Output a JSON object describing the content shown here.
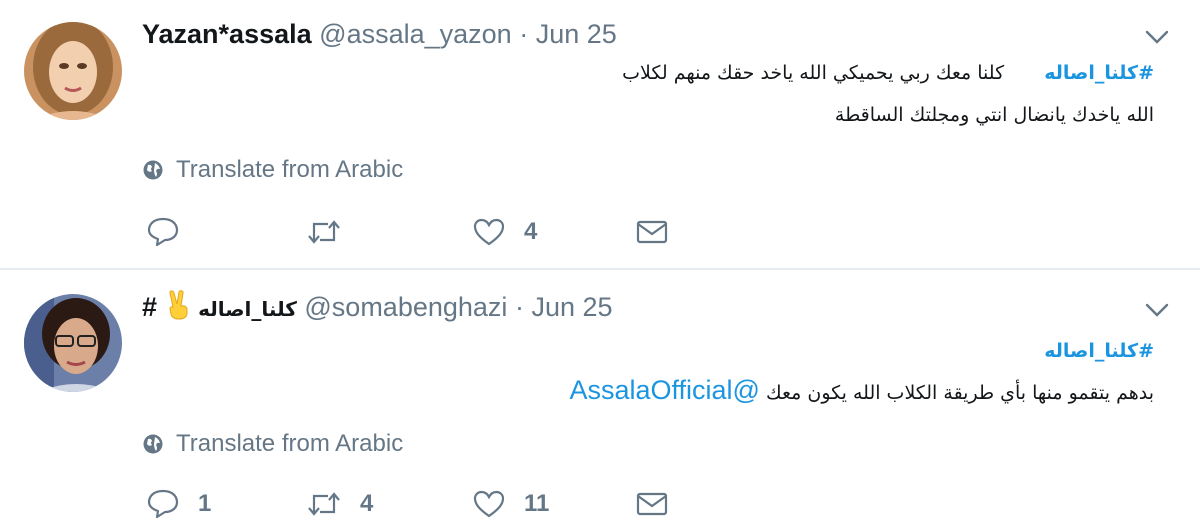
{
  "tweets": [
    {
      "name": "Yazan*assala",
      "handle": "@assala_yazon",
      "sep": "·",
      "date": "Jun 25",
      "hashtag": "#كلنا_اصاله",
      "line1_text": "كلنا معك ربي يحميكي الله ياخد حقك منهم لكلاب",
      "line2_text": "الله ياخدك يانضال انتي ومجلتك الساقطة",
      "translate": "Translate from Arabic",
      "reply_count": "",
      "retweet_count": "",
      "like_count": "4"
    },
    {
      "name_prefix": "#",
      "name_emoji": "✌️",
      "name": "كلنا_اصاله",
      "handle": "@somabenghazi",
      "sep": "·",
      "date": "Jun 25",
      "hashtag": "#كلنا_اصاله",
      "line2_text": "بدهم يتقمو منها بأي طريقة الكلاب  الله يكون معك",
      "mention": "@AssalaOfficial",
      "translate": "Translate from Arabic",
      "reply_count": "1",
      "retweet_count": "4",
      "like_count": "11"
    }
  ],
  "icons": {
    "globe": "globe-icon",
    "reply": "reply-icon",
    "retweet": "retweet-icon",
    "like": "heart-icon",
    "dm": "envelope-icon",
    "caret": "chevron-down-icon"
  },
  "colors": {
    "link": "#1b95e0",
    "muted": "#657786",
    "text": "#14171a",
    "divider": "#e6ecf0"
  }
}
